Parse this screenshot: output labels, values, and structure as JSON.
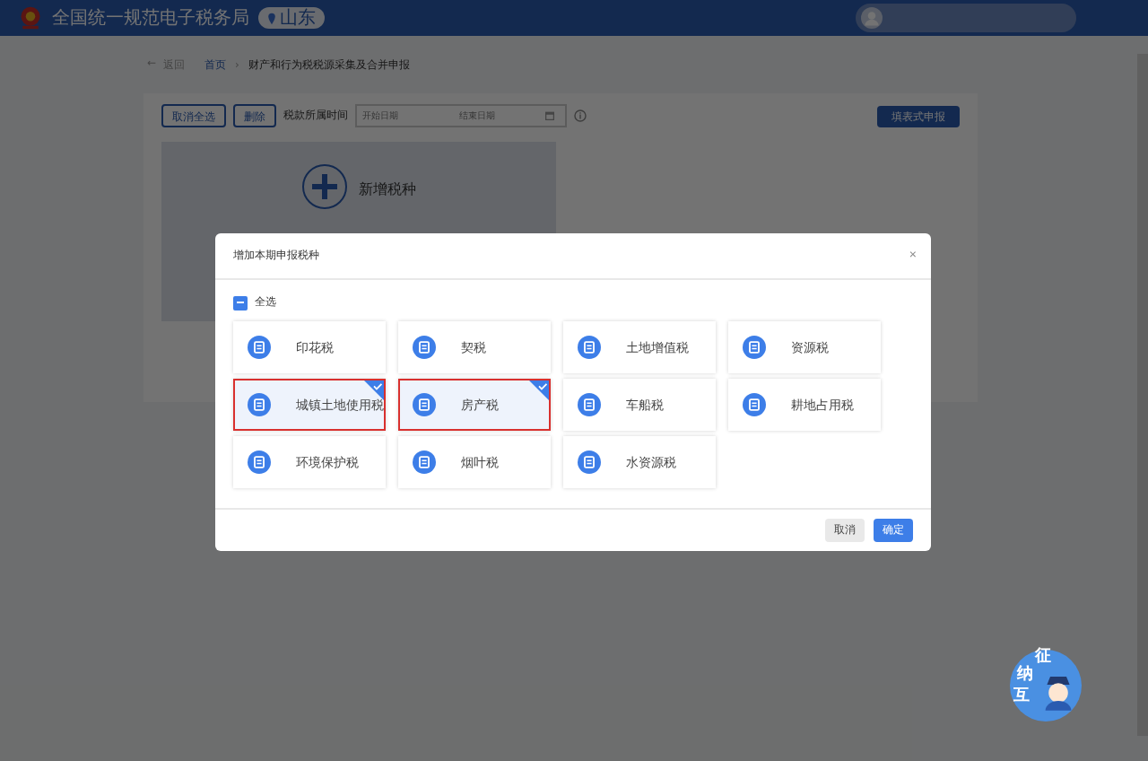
{
  "header": {
    "site_title": "全国统一规范电子税务局",
    "region": "山东"
  },
  "breadcrumb": {
    "back_arrow": "←",
    "back": "返回",
    "separator": "›",
    "items": [
      "首页",
      "财产和行为税税源采集及合并申报"
    ]
  },
  "toolbar": {
    "buttons": [
      "取消全选",
      "删除"
    ],
    "period_label": "税款所属时间",
    "start_placeholder": "开始日期",
    "end_placeholder": "结束日期",
    "primary_button": "填表式申报"
  },
  "add_card": {
    "label": "新增税种"
  },
  "dialog": {
    "title": "增加本期申报税种",
    "close": "×",
    "select_all": {
      "label": "全选",
      "indeterminate": true
    },
    "items": [
      {
        "label": "印花税",
        "selected": false
      },
      {
        "label": "契税",
        "selected": false
      },
      {
        "label": "土地增值税",
        "selected": false
      },
      {
        "label": "资源税",
        "selected": false
      },
      {
        "label": "城镇土地使用税",
        "selected": true
      },
      {
        "label": "房产税",
        "selected": true
      },
      {
        "label": "车船税",
        "selected": false
      },
      {
        "label": "耕地占用税",
        "selected": false
      },
      {
        "label": "环境保护税",
        "selected": false
      },
      {
        "label": "烟叶税",
        "selected": false
      },
      {
        "label": "水资源税",
        "selected": false
      }
    ],
    "buttons": [
      {
        "label": "取消",
        "kind": "secondary"
      },
      {
        "label": "确定",
        "kind": "primary"
      }
    ]
  },
  "assistant_badge": {
    "chars": [
      "征",
      "纳",
      "互"
    ]
  }
}
